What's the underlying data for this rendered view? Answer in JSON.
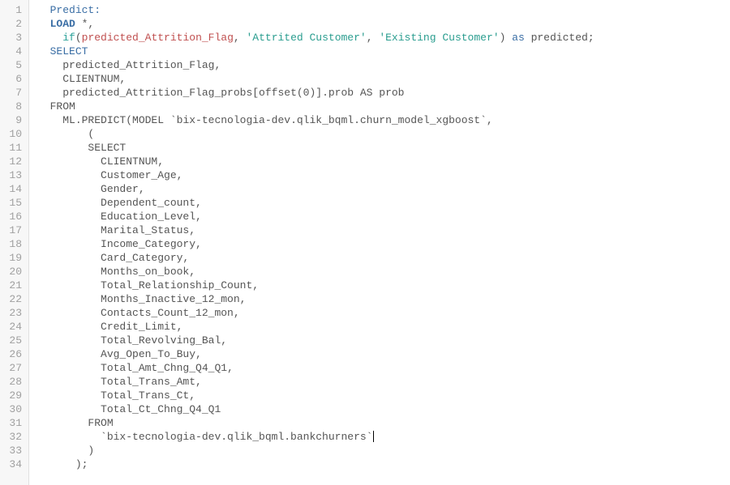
{
  "editor": {
    "lineCount": 34,
    "lines": [
      {
        "indent": 1,
        "segs": [
          {
            "t": "Predict:",
            "c": "kw-blue"
          }
        ]
      },
      {
        "indent": 1,
        "segs": [
          {
            "t": "LOAD",
            "c": "kw-load"
          },
          {
            "t": " *,",
            "c": "punct"
          }
        ]
      },
      {
        "indent": 2,
        "segs": [
          {
            "t": "if",
            "c": "fn-teal"
          },
          {
            "t": "(",
            "c": "punct"
          },
          {
            "t": "predicted_Attrition_Flag",
            "c": "fn-red"
          },
          {
            "t": ", ",
            "c": "punct"
          },
          {
            "t": "'Attrited Customer'",
            "c": "str-green"
          },
          {
            "t": ", ",
            "c": "punct"
          },
          {
            "t": "'Existing Customer'",
            "c": "str-green"
          },
          {
            "t": ") ",
            "c": "punct"
          },
          {
            "t": "as",
            "c": "kw-blue"
          },
          {
            "t": " predicted;",
            "c": "ident"
          }
        ]
      },
      {
        "indent": 1,
        "segs": [
          {
            "t": "SELECT",
            "c": "kw-blue"
          }
        ]
      },
      {
        "indent": 2,
        "segs": [
          {
            "t": "predicted_Attrition_Flag,",
            "c": "ident"
          }
        ]
      },
      {
        "indent": 2,
        "segs": [
          {
            "t": "CLIENTNUM,",
            "c": "ident"
          }
        ]
      },
      {
        "indent": 2,
        "segs": [
          {
            "t": "predicted_Attrition_Flag_probs[offset(0)].prob AS prob",
            "c": "ident"
          }
        ]
      },
      {
        "indent": 1,
        "segs": [
          {
            "t": "FROM",
            "c": "ident"
          }
        ]
      },
      {
        "indent": 2,
        "segs": [
          {
            "t": "ML.PREDICT(MODEL `bix-tecnologia-dev.qlik_bqml.churn_model_xgboost`,",
            "c": "ident"
          }
        ]
      },
      {
        "indent": 4,
        "segs": [
          {
            "t": "(",
            "c": "ident"
          }
        ]
      },
      {
        "indent": 4,
        "segs": [
          {
            "t": "SELECT",
            "c": "ident"
          }
        ]
      },
      {
        "indent": 5,
        "segs": [
          {
            "t": "CLIENTNUM,",
            "c": "ident"
          }
        ]
      },
      {
        "indent": 5,
        "segs": [
          {
            "t": "Customer_Age,",
            "c": "ident"
          }
        ]
      },
      {
        "indent": 5,
        "segs": [
          {
            "t": "Gender,",
            "c": "ident"
          }
        ]
      },
      {
        "indent": 5,
        "segs": [
          {
            "t": "Dependent_count,",
            "c": "ident"
          }
        ]
      },
      {
        "indent": 5,
        "segs": [
          {
            "t": "Education_Level,",
            "c": "ident"
          }
        ]
      },
      {
        "indent": 5,
        "segs": [
          {
            "t": "Marital_Status,",
            "c": "ident"
          }
        ]
      },
      {
        "indent": 5,
        "segs": [
          {
            "t": "Income_Category,",
            "c": "ident"
          }
        ]
      },
      {
        "indent": 5,
        "segs": [
          {
            "t": "Card_Category,",
            "c": "ident"
          }
        ]
      },
      {
        "indent": 5,
        "segs": [
          {
            "t": "Months_on_book,",
            "c": "ident"
          }
        ]
      },
      {
        "indent": 5,
        "segs": [
          {
            "t": "Total_Relationship_Count,",
            "c": "ident"
          }
        ]
      },
      {
        "indent": 5,
        "segs": [
          {
            "t": "Months_Inactive_12_mon,",
            "c": "ident"
          }
        ]
      },
      {
        "indent": 5,
        "segs": [
          {
            "t": "Contacts_Count_12_mon,",
            "c": "ident"
          }
        ]
      },
      {
        "indent": 5,
        "segs": [
          {
            "t": "Credit_Limit,",
            "c": "ident"
          }
        ]
      },
      {
        "indent": 5,
        "segs": [
          {
            "t": "Total_Revolving_Bal,",
            "c": "ident"
          }
        ]
      },
      {
        "indent": 5,
        "segs": [
          {
            "t": "Avg_Open_To_Buy,",
            "c": "ident"
          }
        ]
      },
      {
        "indent": 5,
        "segs": [
          {
            "t": "Total_Amt_Chng_Q4_Q1,",
            "c": "ident"
          }
        ]
      },
      {
        "indent": 5,
        "segs": [
          {
            "t": "Total_Trans_Amt,",
            "c": "ident"
          }
        ]
      },
      {
        "indent": 5,
        "segs": [
          {
            "t": "Total_Trans_Ct,",
            "c": "ident"
          }
        ]
      },
      {
        "indent": 5,
        "segs": [
          {
            "t": "Total_Ct_Chng_Q4_Q1",
            "c": "ident"
          }
        ]
      },
      {
        "indent": 4,
        "segs": [
          {
            "t": "FROM",
            "c": "ident"
          }
        ]
      },
      {
        "indent": 5,
        "segs": [
          {
            "t": "`bix-tecnologia-dev.qlik_bqml.bankchurners`",
            "c": "ident"
          }
        ],
        "cursor": true
      },
      {
        "indent": 4,
        "segs": [
          {
            "t": ")",
            "c": "ident"
          }
        ]
      },
      {
        "indent": 3,
        "segs": [
          {
            "t": ");",
            "c": "ident"
          }
        ]
      }
    ]
  }
}
